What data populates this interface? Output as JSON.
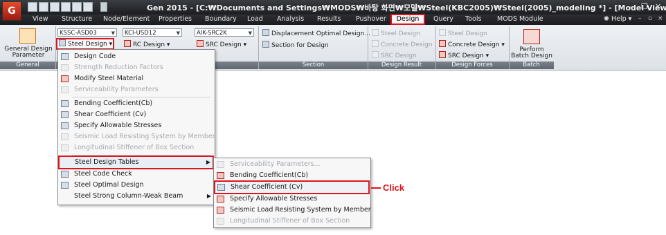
{
  "app": {
    "logo": "G",
    "title": "Gen 2015 - [C:₩Documents and Settings₩MODS₩바탕 화면₩모델₩Steel(KBC2005)₩Steel(2005)_modeling *] - [Model View]"
  },
  "menubar": {
    "items": [
      "View",
      "Structure",
      "Node/Element",
      "Properties",
      "Boundary",
      "Load",
      "Analysis",
      "Results",
      "Pushover",
      "Design",
      "Query",
      "Tools",
      "MODS Module"
    ],
    "help": "Help"
  },
  "ribbon": {
    "general": {
      "button_label": "General Design Parameter",
      "group_label": "General"
    },
    "combos": {
      "steel_code": "KSSC-ASD03",
      "rc_code": "KCI-USD12",
      "src_code": "AIK-SRC2K"
    },
    "buttons": {
      "steel_design": "Steel Design",
      "rc_design": "RC Design",
      "src_design": "SRC Design"
    },
    "section": {
      "displacement": "Displacement Optimal Design...",
      "section_for_design": "Section for Design",
      "group_label": "Section"
    },
    "design_result": {
      "items": [
        "Steel Design",
        "Concrete Design",
        "SRC Design"
      ],
      "group_label": "Design Result"
    },
    "design_forces": {
      "items": [
        "Steel Design",
        "Concrete Design",
        "SRC Design"
      ],
      "group_label": "Design Forces"
    },
    "batch": {
      "button_label": "Perform Batch Design",
      "group_label": "Batch"
    }
  },
  "steel_menu": {
    "items": [
      {
        "label": "Design Code",
        "enabled": true
      },
      {
        "label": "Strength Reduction Factors",
        "enabled": false
      },
      {
        "label": "Modify Steel Material",
        "enabled": true
      },
      {
        "label": "Serviceability Parameters",
        "enabled": false
      },
      {
        "label": "Bending Coefficient(Cb)",
        "enabled": true
      },
      {
        "label": "Shear Coefficient (Cv)",
        "enabled": true
      },
      {
        "label": "Specify Allowable Stresses",
        "enabled": true
      },
      {
        "label": "Seismic Load Resisting System by Member",
        "enabled": false
      },
      {
        "label": "Longitudinal Stiffener of Box Section",
        "enabled": false
      },
      {
        "label": "Steel Design Tables",
        "enabled": true
      },
      {
        "label": "Steel Code Check",
        "enabled": true
      },
      {
        "label": "Steel Optimal Design",
        "enabled": true
      },
      {
        "label": "Steel Strong Column-Weak Beam",
        "enabled": true
      }
    ]
  },
  "tables_submenu": {
    "items": [
      {
        "label": "Serviceability Parameters...",
        "enabled": false
      },
      {
        "label": "Bending Coefficient(Cb)",
        "enabled": true
      },
      {
        "label": "Shear Coefficient (Cv)",
        "enabled": true
      },
      {
        "label": "Specify Allowable Stresses",
        "enabled": true
      },
      {
        "label": "Seismic Load Resisting System by Member",
        "enabled": true
      },
      {
        "label": "Longitudinal Stiffener of Box Section",
        "enabled": false
      }
    ]
  },
  "annotation": {
    "text": "Click",
    "color": "#e0141b"
  }
}
